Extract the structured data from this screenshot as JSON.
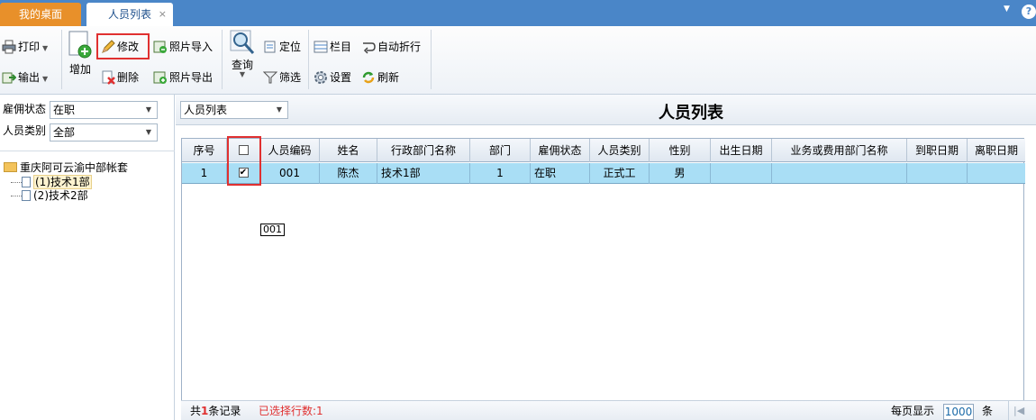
{
  "tabs": {
    "home": "我的桌面",
    "active": "人员列表",
    "close": "×"
  },
  "toolbar": {
    "print": "打印",
    "output": "输出",
    "add": "增加",
    "edit": "修改",
    "delete": "删除",
    "photo_import": "照片导入",
    "photo_export": "照片导出",
    "query": "查询",
    "locate": "定位",
    "filter": "筛选",
    "columns": "栏目",
    "settings": "设置",
    "auto_wrap": "自动折行",
    "refresh": "刷新"
  },
  "filters": {
    "employment_label": "雇佣状态",
    "employment_value": "在职",
    "category_label": "人员类别",
    "category_value": "全部"
  },
  "tree": {
    "root": "重庆阿可云渝中部帐套",
    "nodes": [
      "(1)技术1部",
      "(2)技术2部"
    ]
  },
  "main": {
    "view_select": "人员列表",
    "title": "人员列表"
  },
  "table": {
    "columns": [
      "序号",
      "",
      "人员编码",
      "姓名",
      "行政部门名称",
      "部门",
      "雇佣状态",
      "人员类别",
      "性别",
      "出生日期",
      "业务或费用部门名称",
      "到职日期",
      "离职日期"
    ],
    "rows": [
      {
        "seq": "1",
        "checked": "✔",
        "code": "001",
        "name": "陈杰",
        "dept_name": "技术1部",
        "dept": "1",
        "status": "在职",
        "category": "正式工",
        "gender": "男",
        "birth": "",
        "biz_dept": "",
        "join": "",
        "leave": ""
      }
    ]
  },
  "tooltip": "001",
  "footer": {
    "total_prefix": "共",
    "total_count": "1",
    "total_suffix": "条记录",
    "selected": "已选择行数:1",
    "per_page_label": "每页显示",
    "per_page_value": "1000",
    "per_page_unit": "条"
  },
  "colors": {
    "tabbar": "#4a86c8",
    "home_tab": "#e8902a",
    "selected_row": "#a9def5",
    "highlight": "#e03030",
    "selected_text": "#e03030"
  }
}
